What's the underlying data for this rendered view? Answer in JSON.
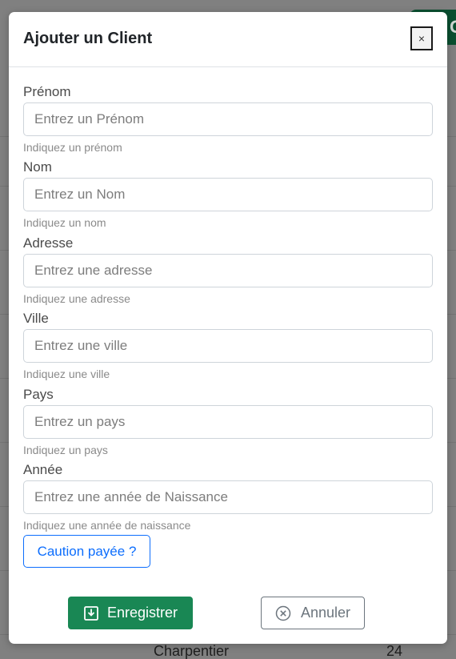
{
  "background": {
    "top_button_label": "C",
    "row_name": "Charpentier",
    "row_value": "24"
  },
  "modal": {
    "title": "Ajouter un Client",
    "close_label": "×",
    "fields": [
      {
        "label": "Prénom",
        "placeholder": "Entrez un Prénom",
        "help": "Indiquez un prénom",
        "value": ""
      },
      {
        "label": "Nom",
        "placeholder": "Entrez un Nom",
        "help": "Indiquez un nom",
        "value": ""
      },
      {
        "label": "Adresse",
        "placeholder": "Entrez une adresse",
        "help": "Indiquez une adresse",
        "value": ""
      },
      {
        "label": "Ville",
        "placeholder": "Entrez une ville",
        "help": "Indiquez une ville",
        "value": ""
      },
      {
        "label": "Pays",
        "placeholder": "Entrez un pays",
        "help": "Indiquez un pays",
        "value": ""
      },
      {
        "label": "Année",
        "placeholder": "Entrez une année de Naissance",
        "help": "Indiquez une année de naissance",
        "value": ""
      }
    ],
    "caution_button": "Caution payée ?",
    "save_button": "Enregistrer",
    "save_icon": "download-icon",
    "cancel_button": "Annuler",
    "cancel_icon": "x-circle-icon"
  },
  "colors": {
    "primary": "#0d6efd",
    "success": "#198754",
    "secondary": "#6c757d"
  }
}
